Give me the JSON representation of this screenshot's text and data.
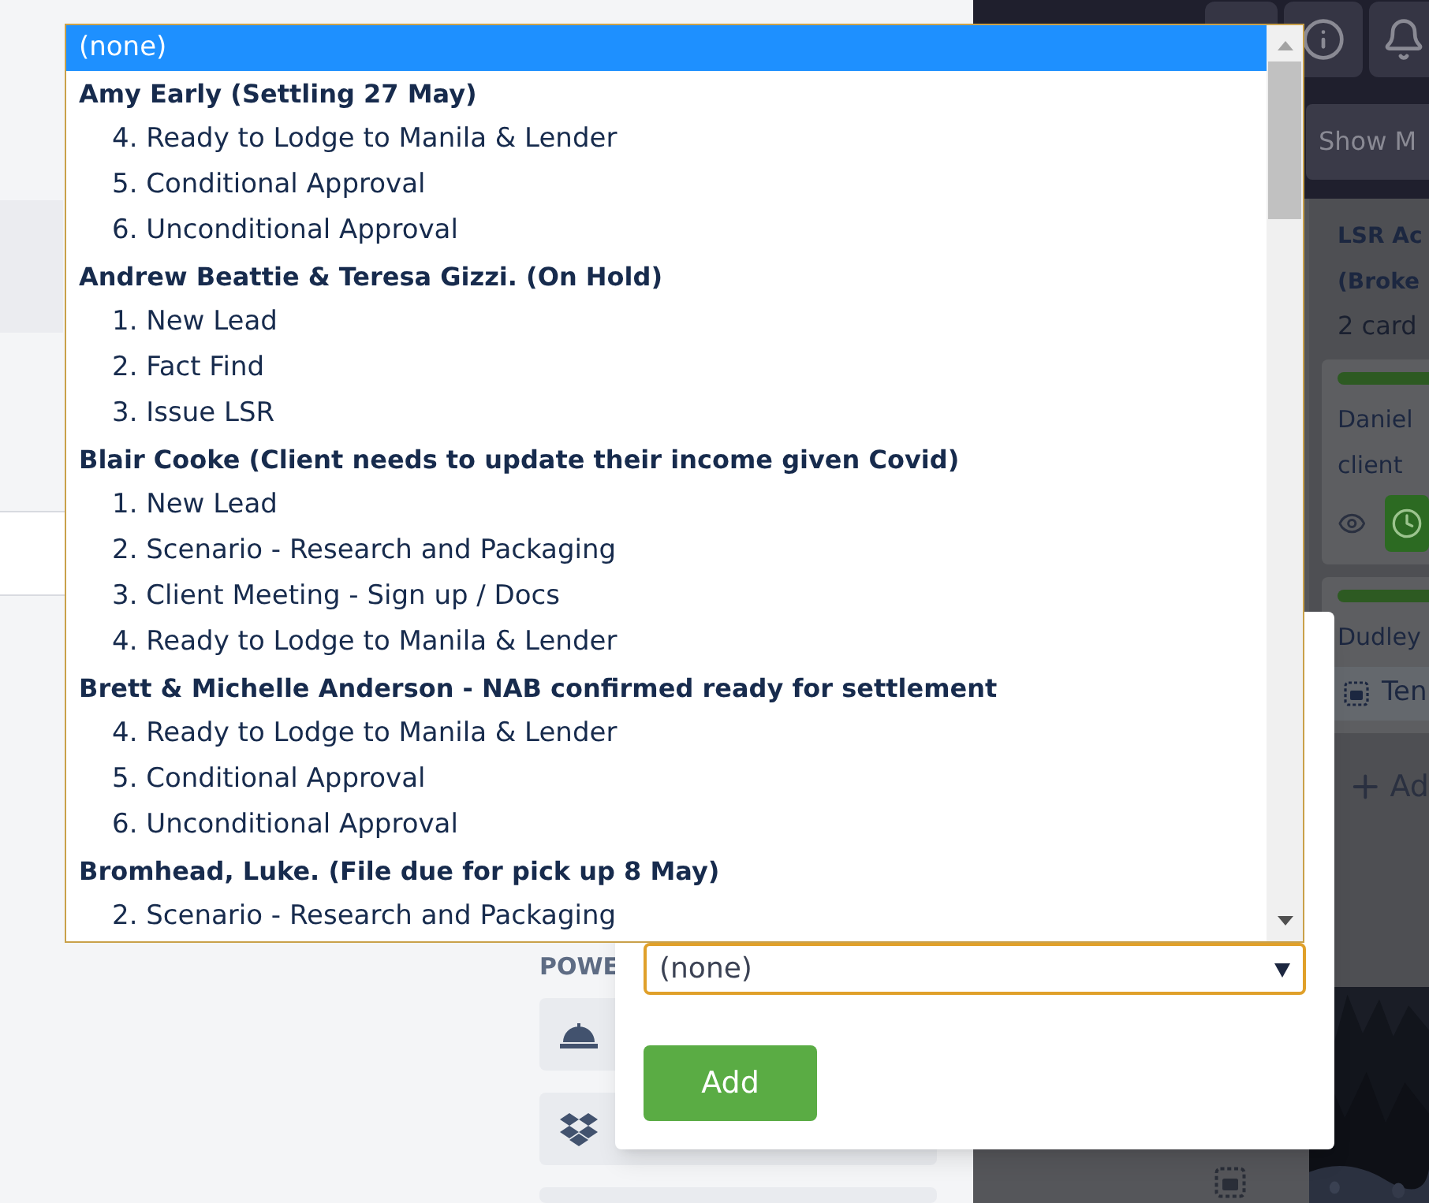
{
  "sidebar": {
    "section_label": "POWE"
  },
  "board": {
    "show_menu_button": "Show M",
    "list": {
      "title_lines": [
        "LSR Ac",
        "(Broke"
      ],
      "count": "2 card",
      "cards": [
        {
          "kind": "watch",
          "lines": [
            "Daniel",
            "client"
          ]
        },
        {
          "kind": "template",
          "lines": [
            "Dudley"
          ],
          "badge": "Ten"
        }
      ],
      "add_card": "Ad"
    }
  },
  "popover": {
    "select": {
      "value": "(none)"
    },
    "add_button": "Add"
  },
  "dropdown": {
    "options": [
      {
        "label": "(none)",
        "selected": true
      }
    ],
    "groups": [
      {
        "label": "Amy Early (Settling 27 May)",
        "options": [
          {
            "label": "4. Ready to Lodge to Manila & Lender",
            "selected": false
          },
          {
            "label": "5. Conditional Approval",
            "selected": false
          },
          {
            "label": "6. Unconditional Approval",
            "selected": false
          }
        ]
      },
      {
        "label": "Andrew Beattie & Teresa Gizzi. (On Hold)",
        "options": [
          {
            "label": "1. New Lead",
            "selected": false
          },
          {
            "label": "2. Fact Find",
            "selected": false
          },
          {
            "label": "3. Issue LSR",
            "selected": false
          }
        ]
      },
      {
        "label": "Blair Cooke (Client needs to update their income given Covid)",
        "options": [
          {
            "label": "1. New Lead",
            "selected": false
          },
          {
            "label": "2. Scenario - Research and Packaging",
            "selected": false
          },
          {
            "label": "3. Client Meeting - Sign up / Docs",
            "selected": false
          },
          {
            "label": "4. Ready to Lodge to Manila & Lender",
            "selected": false
          }
        ]
      },
      {
        "label": "Brett & Michelle Anderson - NAB confirmed ready for settlement",
        "options": [
          {
            "label": "4. Ready to Lodge to Manila & Lender",
            "selected": false
          },
          {
            "label": "5. Conditional Approval",
            "selected": false
          },
          {
            "label": "6. Unconditional Approval",
            "selected": false
          }
        ]
      },
      {
        "label": "Bromhead, Luke. (File due for pick up 8 May)",
        "options": [
          {
            "label": "2. Scenario - Research and Packaging",
            "selected": false
          }
        ]
      }
    ]
  }
}
